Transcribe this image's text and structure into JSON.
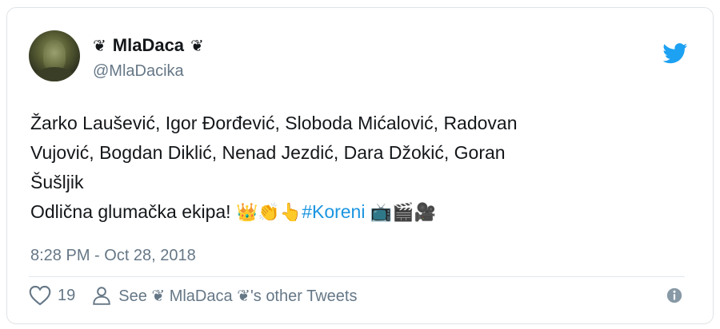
{
  "tweet": {
    "author_name": "MlaDaca",
    "deco_glyph": "❦",
    "handle": "@MlaDacika",
    "text_lines": [
      "Žarko Laušević, Igor Đorđević, Sloboda Mićalović, Radovan",
      "Vujović, Bogdan Diklić, Nenad Jezdić, Dara Džokić, Goran",
      "Šušljik"
    ],
    "last_line_prefix": "Odlična glumačka ekipa!",
    "emojis_before": [
      "👑",
      "👏",
      "👆"
    ],
    "hashtag": "#Koreni",
    "emojis_after": [
      "📺",
      "🎬",
      "🎥"
    ],
    "timestamp": "8:28 PM - Oct 28, 2018",
    "like_count": "19",
    "other_tweets_label": "See ❦ MlaDaca ❦'s other Tweets"
  },
  "icons": {
    "brand": "twitter-bird-icon",
    "like": "heart-icon",
    "profile": "person-icon",
    "info": "info-icon"
  },
  "colors": {
    "twitter_blue": "#1da1f2",
    "hashtag": "#1b95e0",
    "secondary_text": "#657786",
    "primary_text": "#14171a"
  }
}
